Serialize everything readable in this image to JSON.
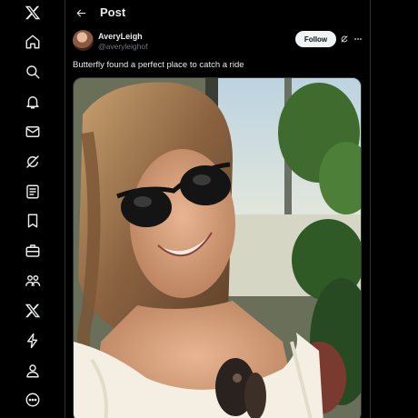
{
  "rail": {
    "items": [
      {
        "name": "x-logo-icon"
      },
      {
        "name": "home-icon"
      },
      {
        "name": "search-icon"
      },
      {
        "name": "notifications-icon"
      },
      {
        "name": "messages-icon"
      },
      {
        "name": "grok-icon"
      },
      {
        "name": "lists-icon"
      },
      {
        "name": "bookmarks-icon"
      },
      {
        "name": "jobs-icon"
      },
      {
        "name": "communities-icon"
      },
      {
        "name": "premium-icon"
      },
      {
        "name": "verified-orgs-icon"
      },
      {
        "name": "profile-icon"
      },
      {
        "name": "more-icon"
      }
    ]
  },
  "header": {
    "title": "Post"
  },
  "post": {
    "display_name": "AveryLeigh",
    "handle": "@averyleighof",
    "follow_label": "Follow",
    "text": "Butterfly found a perfect place to catch a ride"
  },
  "colors": {
    "background": "#000000",
    "text_primary": "#e7e9ea",
    "text_secondary": "#71767b",
    "border": "#2f3336",
    "follow_bg": "#eff3f4"
  }
}
